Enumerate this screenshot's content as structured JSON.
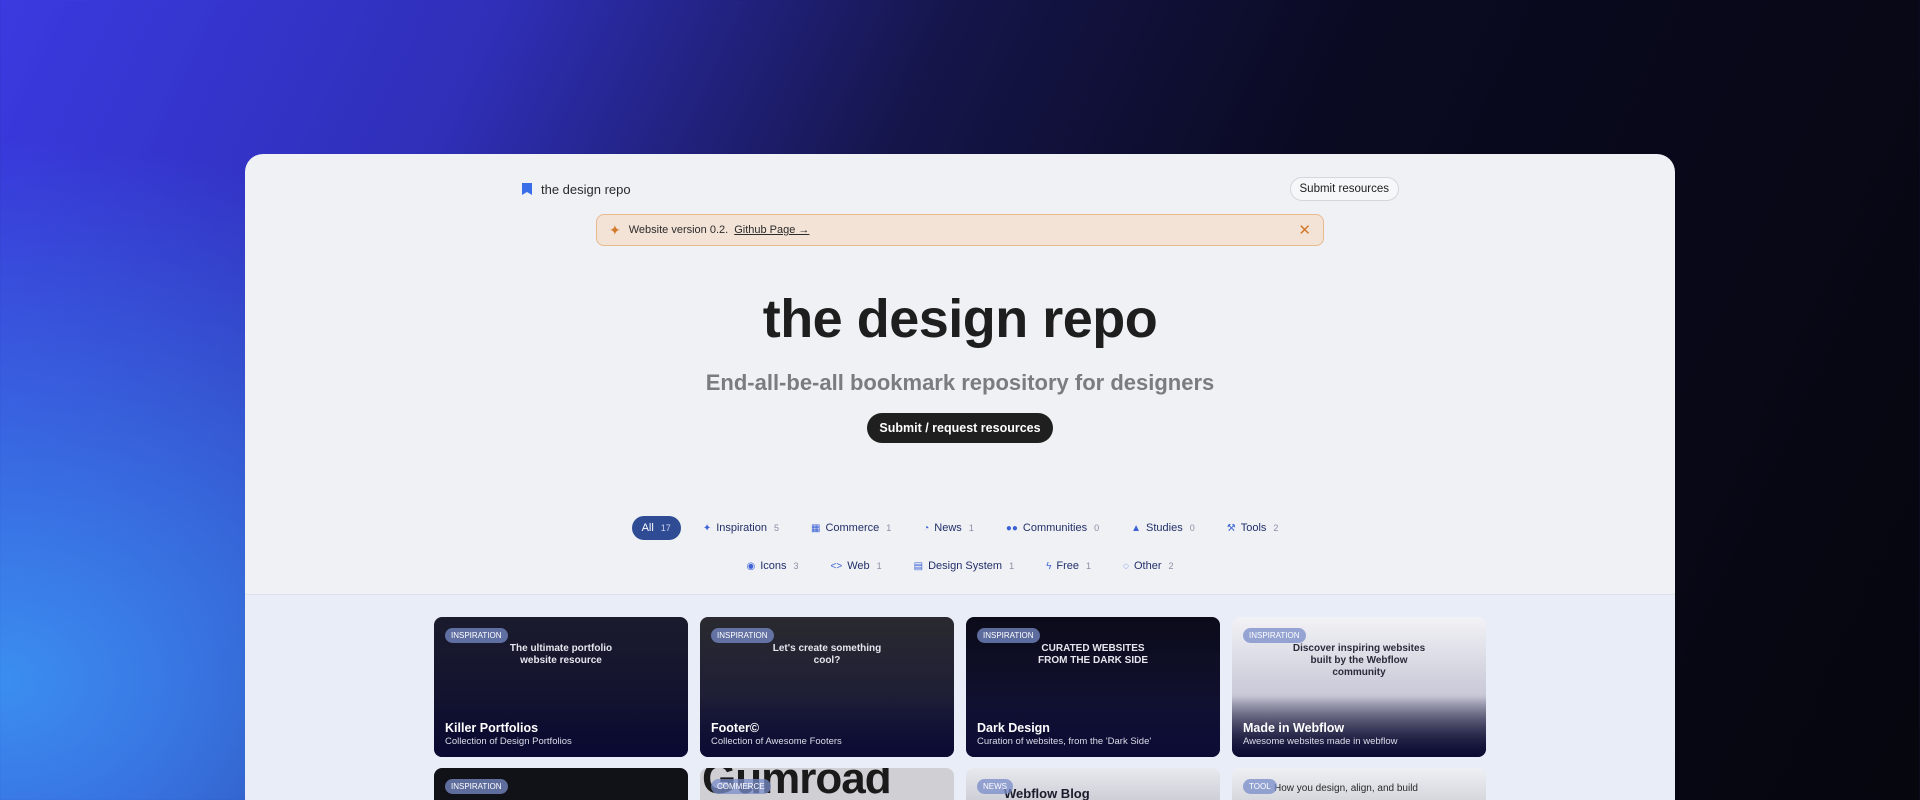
{
  "nav": {
    "brand": "the design repo",
    "submit_button": "Submit resources"
  },
  "banner": {
    "text": "Website version 0.2.",
    "link": "Github Page →"
  },
  "hero": {
    "title": "the design repo",
    "subtitle": "End-all-be-all bookmark repository for designers",
    "cta": "Submit / request resources"
  },
  "filters_row1": [
    {
      "label": "All",
      "count": "17",
      "icon": ""
    },
    {
      "label": "Inspiration",
      "count": "5",
      "icon": "sparkles-icon"
    },
    {
      "label": "Commerce",
      "count": "1",
      "icon": "store-icon"
    },
    {
      "label": "News",
      "count": "1",
      "icon": "rss-icon"
    },
    {
      "label": "Communities",
      "count": "0",
      "icon": "users-icon"
    },
    {
      "label": "Studies",
      "count": "0",
      "icon": "graduation-cap-icon"
    },
    {
      "label": "Tools",
      "count": "2",
      "icon": "wrench-icon"
    }
  ],
  "filters_row2": [
    {
      "label": "Icons",
      "count": "3",
      "icon": "icons-icon"
    },
    {
      "label": "Web",
      "count": "1",
      "icon": "code-icon"
    },
    {
      "label": "Design System",
      "count": "1",
      "icon": "document-icon"
    },
    {
      "label": "Free",
      "count": "1",
      "icon": "bolt-icon"
    },
    {
      "label": "Other",
      "count": "2",
      "icon": "circle-dashed-icon"
    }
  ],
  "cards": [
    {
      "tag": "INSPIRATION",
      "title": "Killer Portfolios",
      "desc": "Collection of Design Portfolios",
      "preview": "The ultimate portfolio website resource"
    },
    {
      "tag": "INSPIRATION",
      "title": "Footer©",
      "desc": "Collection of Awesome Footers",
      "preview": "Let's create something cool?"
    },
    {
      "tag": "INSPIRATION",
      "title": "Dark Design",
      "desc": "Curation of websites, from the 'Dark Side'",
      "preview": "CURATED WEBSITES FROM THE DARK SIDE"
    },
    {
      "tag": "INSPIRATION",
      "title": "Made in Webflow",
      "desc": "Awesome websites made in webflow",
      "preview": "Discover inspiring websites built by the Webflow community"
    }
  ],
  "cards_row2": [
    {
      "tag": "INSPIRATION",
      "preview": ""
    },
    {
      "tag": "COMMERCE",
      "preview": "Gumroad"
    },
    {
      "tag": "NEWS",
      "preview": "Webflow Blog"
    },
    {
      "tag": "TOOL",
      "preview": "How you design, align, and build"
    }
  ]
}
